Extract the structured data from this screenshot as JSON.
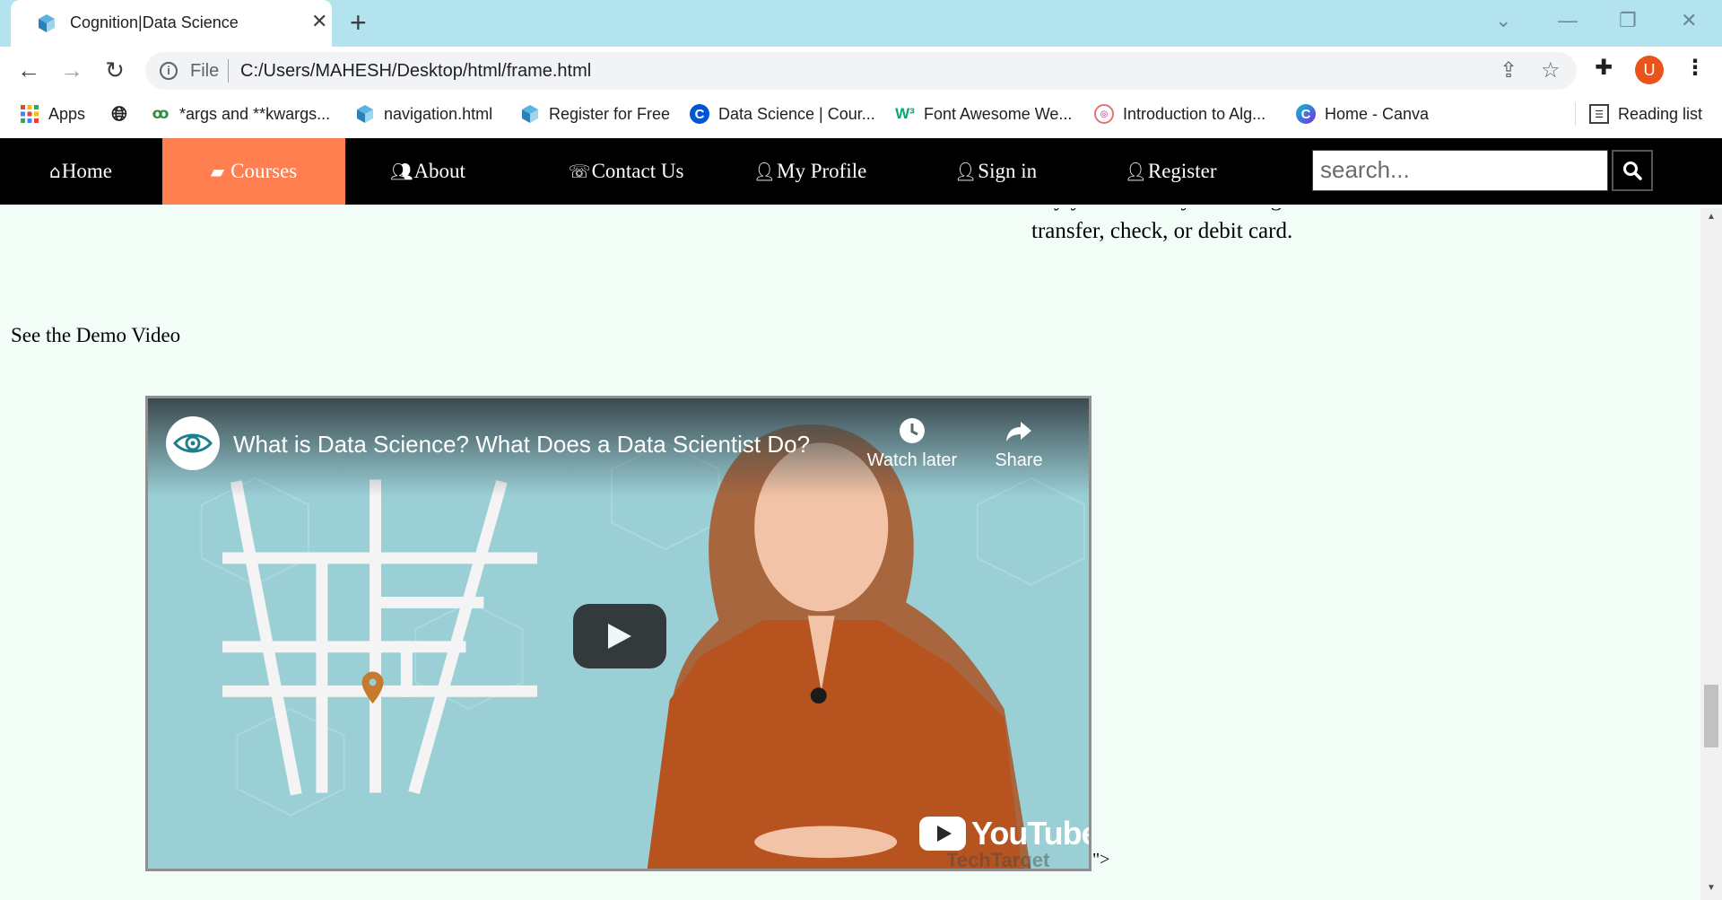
{
  "browser": {
    "tab_title": "Cognition|Data Science",
    "close_tab": "✕",
    "new_tab": "+",
    "url_prefix": "File",
    "url": "C:/Users/MAHESH/Desktop/html/frame.html",
    "profile_initial": "U",
    "bookmarks": [
      {
        "label": "Apps",
        "icon": "apps-grid-icon"
      },
      {
        "label": "",
        "icon": "globe-icon"
      },
      {
        "label": "*args and **kwargs...",
        "icon": "geeksforgeeks-icon"
      },
      {
        "label": "navigation.html",
        "icon": "cube-file-icon"
      },
      {
        "label": "Register for Free",
        "icon": "cube-file-icon"
      },
      {
        "label": "Data Science | Cour...",
        "icon": "coursera-icon"
      },
      {
        "label": "Font Awesome We...",
        "icon": "w3-icon"
      },
      {
        "label": "Introduction to Alg...",
        "icon": "gfg-circle-icon"
      },
      {
        "label": "Home - Canva",
        "icon": "canva-icon"
      }
    ],
    "reading_list": "Reading list"
  },
  "site_nav": {
    "items": [
      {
        "label": "Home",
        "icon": "home-icon"
      },
      {
        "label": "Courses",
        "icon": "book-icon",
        "active": true
      },
      {
        "label": "About",
        "icon": "users-icon"
      },
      {
        "label": "Contact Us",
        "icon": "phone-icon"
      },
      {
        "label": "My Profile",
        "icon": "user-icon"
      },
      {
        "label": "Sign in",
        "icon": "user-plus-icon"
      },
      {
        "label": "Register",
        "icon": "user-icon"
      }
    ],
    "search_placeholder": "search...",
    "active_color": "#ff7f50"
  },
  "content": {
    "pay_text_line1": "Pay your monthly bill using a bank",
    "pay_text_line2": "transfer, check, or debit card.",
    "demo_heading": "See the Demo Video",
    "trailing_text": "\">"
  },
  "video": {
    "title": "What is Data Science? What Does a Data Scientist Do?",
    "watch_later": "Watch later",
    "share": "Share",
    "platform": "YouTube",
    "watermark": "TechTarget"
  }
}
